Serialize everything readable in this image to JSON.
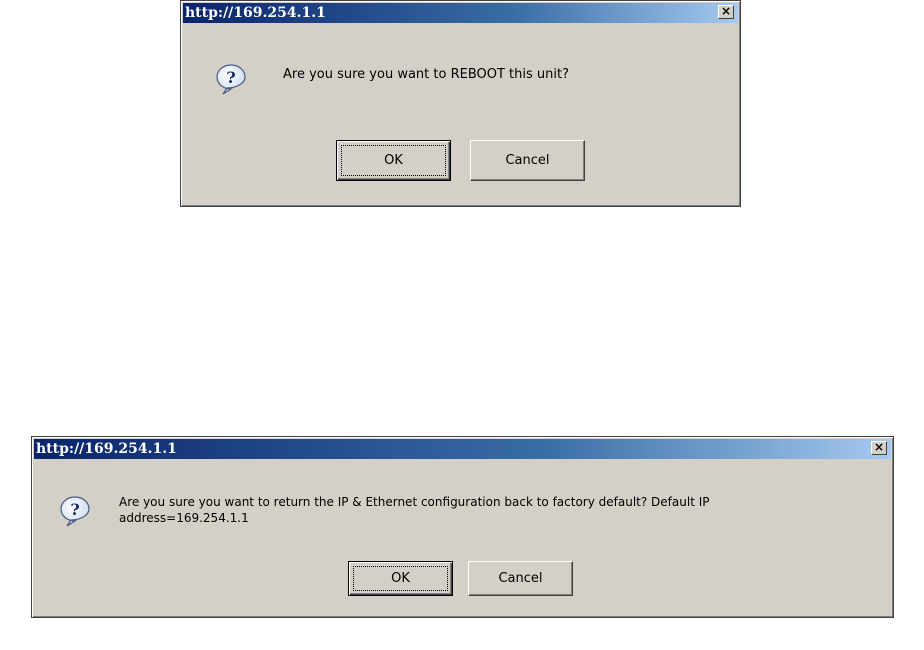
{
  "dialog1": {
    "title": "http://169.254.1.1",
    "close_glyph": "×",
    "icon": "question-icon",
    "message": "Are you sure you want to REBOOT this unit?",
    "ok_label": "OK",
    "cancel_label": "Cancel"
  },
  "dialog2": {
    "title": "http://169.254.1.1",
    "close_glyph": "×",
    "icon": "question-icon",
    "message_line1": "Are you sure you want to return the IP & Ethernet configuration back to factory default? Default IP",
    "message_line2": "address=169.254.1.1",
    "ok_label": "OK",
    "cancel_label": "Cancel"
  },
  "colors": {
    "dialog_face": "#d4d0c8",
    "titlebar_start": "#0a246a",
    "titlebar_end": "#a6caf0"
  }
}
